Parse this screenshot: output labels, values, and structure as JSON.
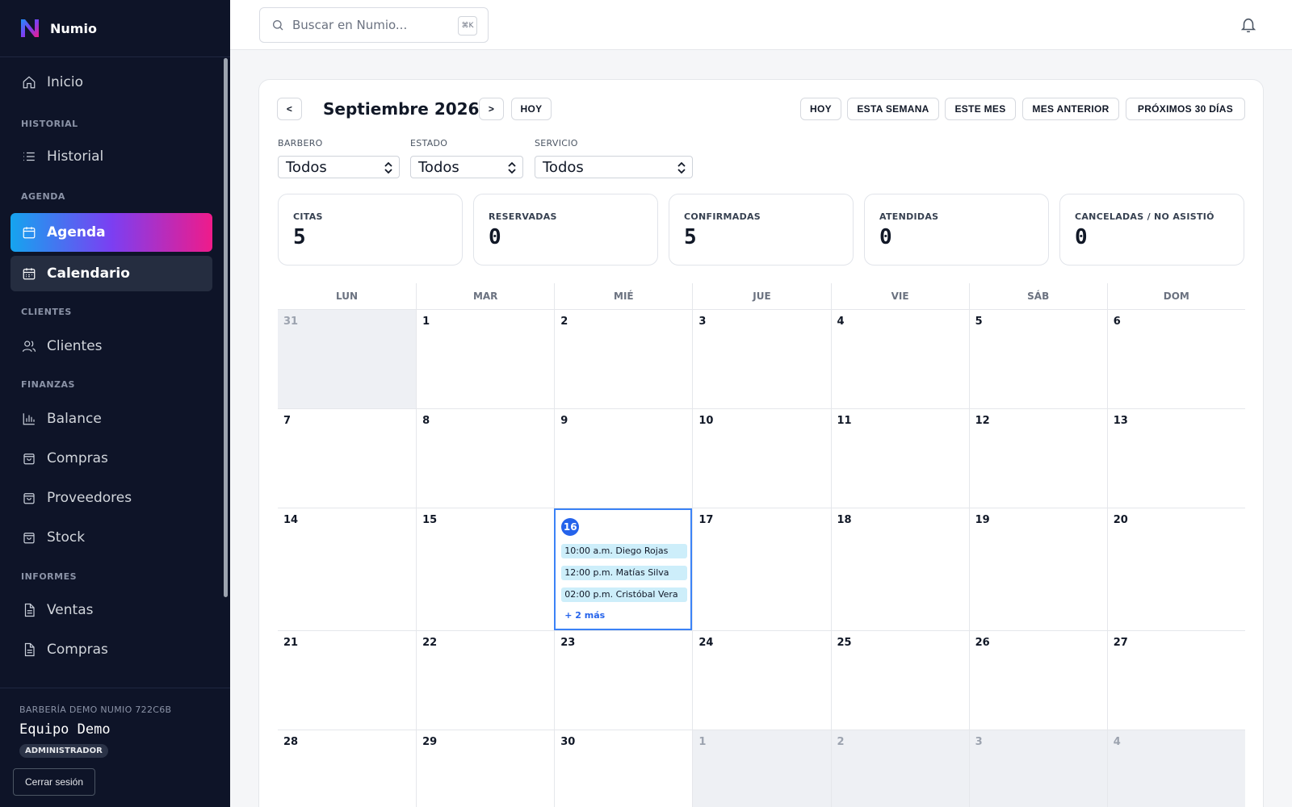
{
  "app": {
    "name": "Numio"
  },
  "sidebar": {
    "home": "Inicio",
    "sections": [
      {
        "title": "HISTORIAL",
        "items": [
          "Historial"
        ]
      },
      {
        "title": "AGENDA",
        "items": [
          "Agenda",
          "Calendario"
        ]
      },
      {
        "title": "CLIENTES",
        "items": [
          "Clientes"
        ]
      },
      {
        "title": "FINANZAS",
        "items": [
          "Balance",
          "Compras",
          "Proveedores",
          "Stock"
        ]
      },
      {
        "title": "INFORMES",
        "items": [
          "Ventas",
          "Compras"
        ]
      }
    ],
    "footer": {
      "org": "BARBERÍA DEMO NUMIO 722C6B",
      "team": "Equipo Demo",
      "role": "ADMINISTRADOR",
      "logout": "Cerrar sesión"
    }
  },
  "topbar": {
    "search_placeholder": "Buscar en Numio...",
    "shortcut": "⌘K"
  },
  "calendar": {
    "title": "Septiembre 2026",
    "prev": "<",
    "next": ">",
    "today": "HOY",
    "quick_filters": [
      "HOY",
      "ESTA SEMANA",
      "ESTE MES",
      "MES ANTERIOR",
      "PRÓXIMOS 30 DÍAS"
    ],
    "filters": [
      {
        "label": "BARBERO",
        "value": "Todos"
      },
      {
        "label": "ESTADO",
        "value": "Todos"
      },
      {
        "label": "SERVICIO",
        "value": "Todos"
      }
    ],
    "stats": [
      {
        "label": "CITAS",
        "value": "5"
      },
      {
        "label": "RESERVADAS",
        "value": "0"
      },
      {
        "label": "CONFIRMADAS",
        "value": "5"
      },
      {
        "label": "ATENDIDAS",
        "value": "0"
      },
      {
        "label": "CANCELADAS / NO ASISTIÓ",
        "value": "0"
      }
    ],
    "weekdays": [
      "LUN",
      "MAR",
      "MIÉ",
      "JUE",
      "VIE",
      "SÁB",
      "DOM"
    ],
    "weeks": [
      [
        "31",
        "1",
        "2",
        "3",
        "4",
        "5",
        "6"
      ],
      [
        "7",
        "8",
        "9",
        "10",
        "11",
        "12",
        "13"
      ],
      [
        "14",
        "15",
        "16",
        "17",
        "18",
        "19",
        "20"
      ],
      [
        "21",
        "22",
        "23",
        "24",
        "25",
        "26",
        "27"
      ],
      [
        "28",
        "29",
        "30",
        "1",
        "2",
        "3",
        "4"
      ]
    ],
    "events": [
      "10:00 a.m. Diego Rojas",
      "12:00 p.m. Matías Silva",
      "02:00 p.m. Cristóbal Vera"
    ],
    "more": "+ 2 más"
  }
}
